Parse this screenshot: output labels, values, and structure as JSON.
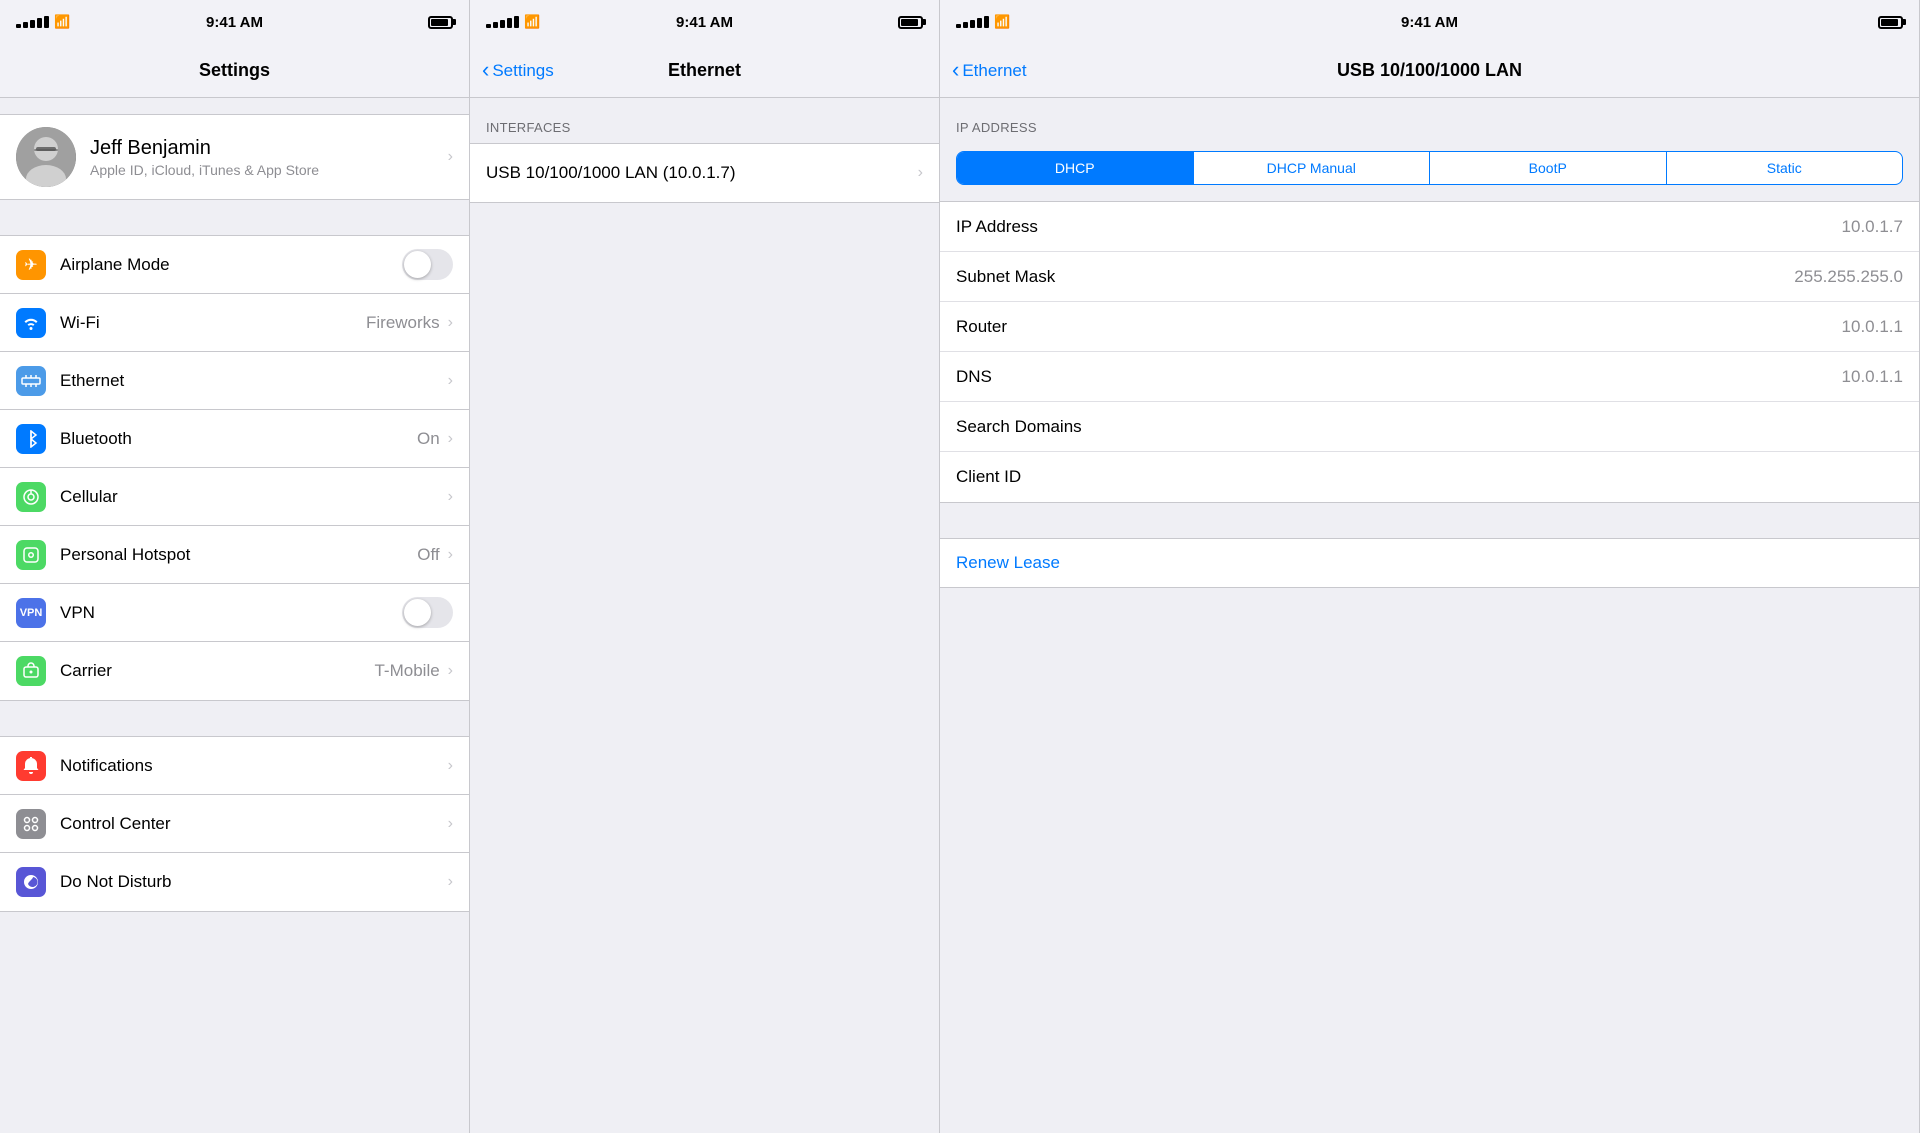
{
  "panel1": {
    "statusBar": {
      "time": "9:41 AM",
      "signalBars": 5,
      "wifi": true,
      "battery": 80
    },
    "title": "Settings",
    "profile": {
      "name": "Jeff Benjamin",
      "subtitle": "Apple ID, iCloud, iTunes & App Store"
    },
    "items": [
      {
        "id": "airplane-mode",
        "label": "Airplane Mode",
        "type": "toggle",
        "value": false,
        "iconBg": "#ff9500",
        "icon": "✈"
      },
      {
        "id": "wifi",
        "label": "Wi-Fi",
        "type": "value-chevron",
        "value": "Fireworks",
        "iconBg": "#007aff",
        "icon": "📶"
      },
      {
        "id": "ethernet",
        "label": "Ethernet",
        "type": "chevron",
        "value": "",
        "iconBg": "#4c9be8",
        "icon": "↔"
      },
      {
        "id": "bluetooth",
        "label": "Bluetooth",
        "type": "value-chevron",
        "value": "On",
        "iconBg": "#007aff",
        "icon": "✦"
      },
      {
        "id": "cellular",
        "label": "Cellular",
        "type": "chevron",
        "value": "",
        "iconBg": "#4cd964",
        "icon": "((·))"
      },
      {
        "id": "personal-hotspot",
        "label": "Personal Hotspot",
        "type": "value-chevron",
        "value": "Off",
        "iconBg": "#4cd964",
        "icon": "⊕"
      },
      {
        "id": "vpn",
        "label": "VPN",
        "type": "toggle",
        "value": false,
        "iconBg": "#4c72e8",
        "icon": "VPN"
      },
      {
        "id": "carrier",
        "label": "Carrier",
        "type": "value-chevron",
        "value": "T-Mobile",
        "iconBg": "#4cd964",
        "icon": "📞"
      }
    ],
    "section2": [
      {
        "id": "notifications",
        "label": "Notifications",
        "type": "chevron",
        "value": "",
        "iconBg": "#ff3b30",
        "icon": "🔔"
      },
      {
        "id": "control-center",
        "label": "Control Center",
        "type": "chevron",
        "value": "",
        "iconBg": "#8e8e93",
        "icon": "⊞"
      },
      {
        "id": "do-not-disturb",
        "label": "Do Not Disturb",
        "type": "chevron",
        "value": "",
        "iconBg": "#5856d6",
        "icon": "🌙"
      }
    ]
  },
  "panel2": {
    "statusBar": {
      "time": "9:41 AM"
    },
    "backLabel": "Settings",
    "title": "Ethernet",
    "sectionHeader": "INTERFACES",
    "interfaces": [
      {
        "id": "usb-lan",
        "label": "USB 10/100/1000 LAN (10.0.1.7)"
      }
    ]
  },
  "panel3": {
    "statusBar": {
      "time": "9:41 AM"
    },
    "backLabel": "Ethernet",
    "title": "USB 10/100/1000 LAN",
    "sectionHeader": "IP ADDRESS",
    "segments": [
      "DHCP",
      "DHCP Manual",
      "BootP",
      "Static"
    ],
    "activeSegment": 0,
    "fields": [
      {
        "id": "ip-address",
        "label": "IP Address",
        "value": "10.0.1.7"
      },
      {
        "id": "subnet-mask",
        "label": "Subnet Mask",
        "value": "255.255.255.0"
      },
      {
        "id": "router",
        "label": "Router",
        "value": "10.0.1.1"
      },
      {
        "id": "dns",
        "label": "DNS",
        "value": "10.0.1.1"
      },
      {
        "id": "search-domains",
        "label": "Search Domains",
        "value": ""
      },
      {
        "id": "client-id",
        "label": "Client ID",
        "value": ""
      }
    ],
    "renewLabel": "Renew Lease"
  }
}
